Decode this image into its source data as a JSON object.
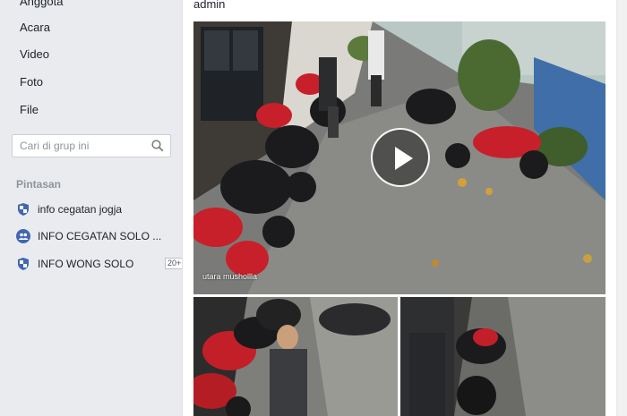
{
  "sidebar": {
    "nav": [
      {
        "label": "Anggota"
      },
      {
        "label": "Acara"
      },
      {
        "label": "Video"
      },
      {
        "label": "Foto"
      },
      {
        "label": "File"
      }
    ],
    "search": {
      "placeholder": "Cari di grup ini"
    },
    "shortcuts_title": "Pintasan",
    "shortcuts": [
      {
        "label": "info cegatan jogja",
        "icon": "group-shield-icon"
      },
      {
        "label": "INFO CEGATAN SOLO ...",
        "icon": "group-people-icon"
      },
      {
        "label": "INFO WONG SOLO",
        "icon": "group-shield-icon",
        "badge": "20+"
      }
    ]
  },
  "post": {
    "author_role": "admin",
    "video": {
      "overlay_text": "utara mushollla"
    },
    "photos": [
      {
        "name": "photo-thumbnail-left"
      },
      {
        "name": "photo-thumbnail-right"
      }
    ]
  },
  "colors": {
    "page_bg": "#e9ebee",
    "accent_blue": "#4267b2",
    "text": "#1d2129",
    "muted": "#90949c"
  }
}
